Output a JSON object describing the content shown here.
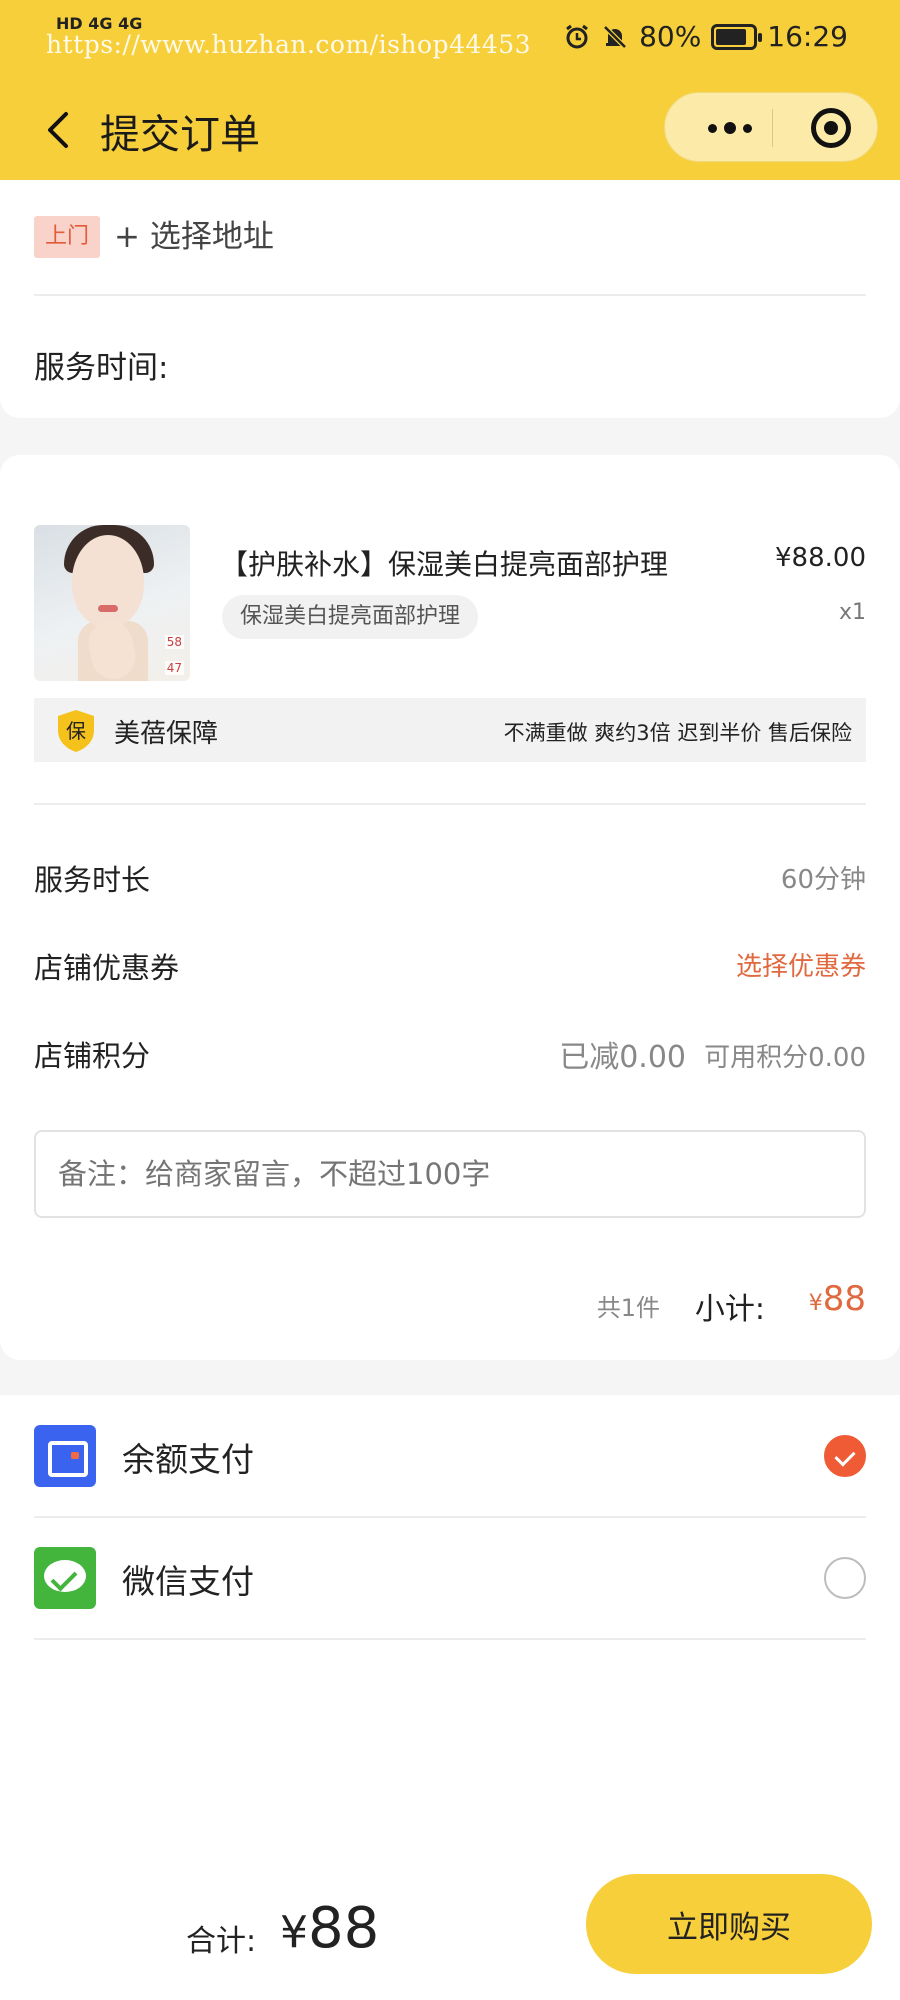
{
  "status_bar": {
    "network": "HD 4G 4G",
    "watermark": "https://www.huzhan.com/ishop44453",
    "battery": "80%",
    "time": "16:29"
  },
  "nav": {
    "title": "提交订单"
  },
  "address": {
    "tag": "上门",
    "select_label": "+ 选择地址",
    "service_time_label": "服务时间:"
  },
  "order": {
    "product_name": "【护肤补水】保湿美白提亮面部护理",
    "price": "¥88.00",
    "spec": "保湿美白提亮面部护理",
    "qty": "x1",
    "thumb_tags": [
      "58",
      "47"
    ],
    "guarantee": {
      "icon_char": "保",
      "title": "美蓓保障",
      "items": "不满重做 爽约3倍 迟到半价 售后保险"
    },
    "duration_label": "服务时长",
    "duration_value": "60分钟",
    "coupon_label": "店铺优惠券",
    "coupon_value": "选择优惠券",
    "points_label": "店铺积分",
    "points_reduced": "已减0.00",
    "points_available": "可用积分0.00",
    "remark_placeholder": "备注：给商家留言，不超过100字",
    "total_count": "共1件",
    "subtotal_label": "小计:",
    "subtotal_currency": "¥",
    "subtotal_amount": "88"
  },
  "payment": {
    "methods": [
      {
        "label": "余额支付",
        "icon": "wallet-icon",
        "selected": true
      },
      {
        "label": "微信支付",
        "icon": "wechat-icon",
        "selected": false
      }
    ]
  },
  "bottom": {
    "total_label": "合计:",
    "total_currency": "¥",
    "total_amount": "88",
    "buy_label": "立即购买"
  },
  "colors": {
    "brand_yellow": "#f7cf3a",
    "accent_orange": "#e0693f",
    "selected_radio": "#ef5b34"
  }
}
